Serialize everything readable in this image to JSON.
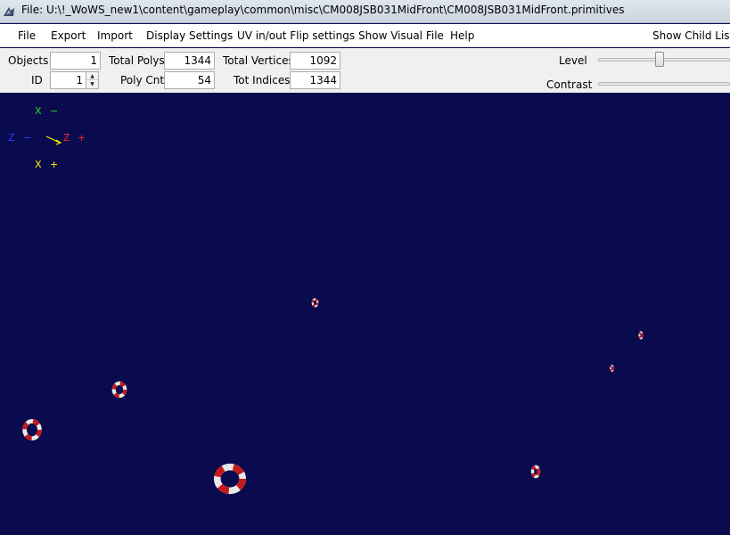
{
  "window": {
    "title": "File: U:\\!_WoWS_new1\\content\\gameplay\\common\\misc\\CM008JSB031MidFront\\CM008JSB031MidFront.primitives"
  },
  "menu": {
    "items": [
      "File",
      "Export",
      "Import",
      "Display Settings",
      "UV in/out Flip settings",
      "Show Visual File",
      "Help"
    ],
    "right_item": "Show Child List"
  },
  "stats": {
    "objects_label": "Objects",
    "objects_value": "1",
    "id_label": "ID",
    "id_value": "1",
    "total_polys_label": "Total Polys",
    "total_polys_value": "1344",
    "poly_cnt_label": "Poly Cnt",
    "poly_cnt_value": "54",
    "total_vertices_label": "Total Vertices",
    "total_vertices_value": "1092",
    "tot_indices_label": "Tot Indices",
    "tot_indices_value": "1344"
  },
  "sliders": {
    "level_label": "Level",
    "contrast_label": "Contrast"
  },
  "viewport": {
    "background": "#0a0a4e",
    "axes": {
      "x_neg_label": "X",
      "x_neg_sign": "−",
      "z_neg_label": "Z",
      "z_neg_sign": "−",
      "z_pos_label": "Z",
      "z_pos_sign": "+",
      "x_pos_label": "X",
      "x_pos_sign": "+"
    },
    "object_count": 8,
    "object_icon": "life-ring"
  },
  "colors": {
    "axis_green": "#22dd22",
    "axis_blue": "#2244ff",
    "axis_red": "#ff2222",
    "axis_yellow": "#ffee00"
  }
}
